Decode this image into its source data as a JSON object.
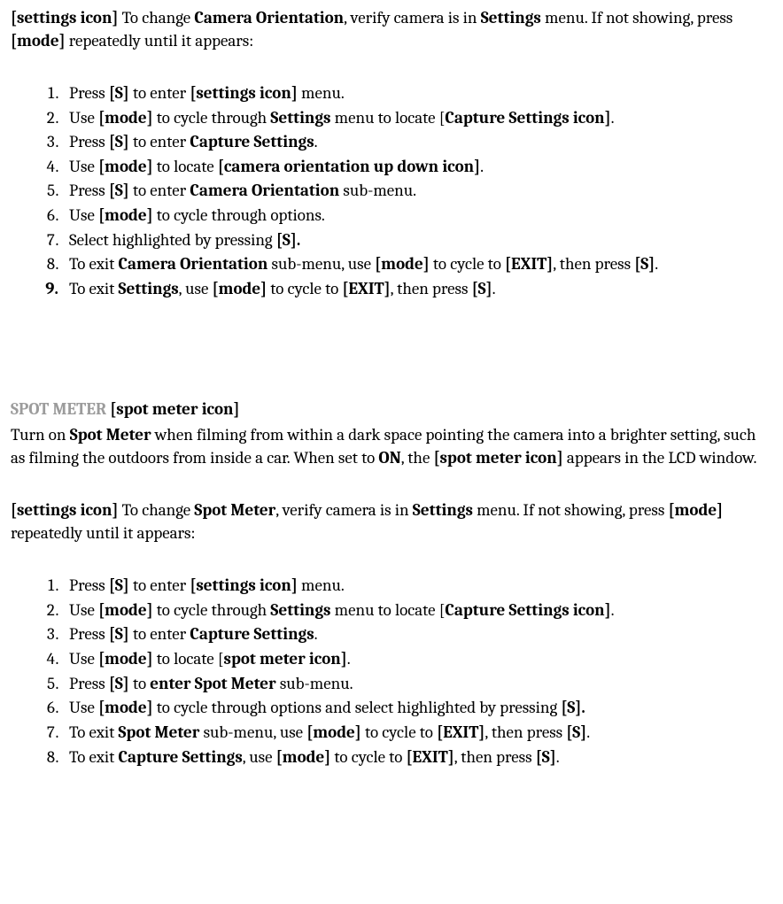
{
  "section1": {
    "intro_runs": [
      {
        "t": "[settings icon] ",
        "b": true
      },
      {
        "t": "To change ",
        "b": false
      },
      {
        "t": "Camera Orientation",
        "b": true
      },
      {
        "t": ", verify camera is in ",
        "b": false
      },
      {
        "t": "Settings",
        "b": true
      },
      {
        "t": " menu. If not showing, press ",
        "b": false
      },
      {
        "t": "[mode]",
        "b": true
      },
      {
        "t": " repeatedly until it appears:",
        "b": false
      }
    ],
    "steps": [
      [
        {
          "t": "Press ",
          "b": false
        },
        {
          "t": "[S]",
          "b": true
        },
        {
          "t": " to enter ",
          "b": false
        },
        {
          "t": "[settings icon]",
          "b": true
        },
        {
          "t": " menu.",
          "b": false
        }
      ],
      [
        {
          "t": "Use ",
          "b": false
        },
        {
          "t": "[mode]",
          "b": true
        },
        {
          "t": " to cycle through ",
          "b": false
        },
        {
          "t": "Settings",
          "b": true
        },
        {
          "t": " menu to locate [",
          "b": false
        },
        {
          "t": "Capture Settings icon]",
          "b": true
        },
        {
          "t": ".",
          "b": false
        }
      ],
      [
        {
          "t": "Press ",
          "b": false
        },
        {
          "t": "[S]",
          "b": true
        },
        {
          "t": " to enter ",
          "b": false
        },
        {
          "t": "Capture Settings",
          "b": true
        },
        {
          "t": ".",
          "b": false
        }
      ],
      [
        {
          "t": "Use ",
          "b": false
        },
        {
          "t": "[mode]",
          "b": true
        },
        {
          "t": " to locate ",
          "b": false
        },
        {
          "t": "[camera orientation up down icon]",
          "b": true
        },
        {
          "t": ".",
          "b": false
        }
      ],
      [
        {
          "t": "Press ",
          "b": false
        },
        {
          "t": "[S]",
          "b": true
        },
        {
          "t": " to enter ",
          "b": false
        },
        {
          "t": "Camera Orientation",
          "b": true
        },
        {
          "t": " sub-menu.",
          "b": false
        }
      ],
      [
        {
          "t": "Use ",
          "b": false
        },
        {
          "t": "[mode]",
          "b": true
        },
        {
          "t": " to cycle through options.",
          "b": false
        }
      ],
      [
        {
          "t": "Select highlighted by pressing ",
          "b": false
        },
        {
          "t": "[S].",
          "b": true
        }
      ],
      [
        {
          "t": "To exit ",
          "b": false
        },
        {
          "t": "Camera Orientation",
          "b": true
        },
        {
          "t": " sub-menu, use ",
          "b": false
        },
        {
          "t": "[mode]",
          "b": true
        },
        {
          "t": " to cycle to ",
          "b": false
        },
        {
          "t": "[EXIT]",
          "b": true
        },
        {
          "t": ", then press ",
          "b": false
        },
        {
          "t": "[S]",
          "b": true
        },
        {
          "t": ".",
          "b": false
        }
      ],
      [
        {
          "t": "To exit ",
          "b": false
        },
        {
          "t": "Settings",
          "b": true
        },
        {
          "t": ", use ",
          "b": false
        },
        {
          "t": "[mode]",
          "b": true
        },
        {
          "t": " to cycle to ",
          "b": false
        },
        {
          "t": "[EXIT]",
          "b": true
        },
        {
          "t": ", then press ",
          "b": false
        },
        {
          "t": "[S]",
          "b": true
        },
        {
          "t": ".",
          "b": false
        }
      ]
    ],
    "step9_numbold": true
  },
  "section2": {
    "heading_gray": "SPOT METER ",
    "heading_black": "[spot meter icon]",
    "desc_runs": [
      {
        "t": "Turn on ",
        "b": false
      },
      {
        "t": "Spot Meter",
        "b": true
      },
      {
        "t": " when filming from within a dark space pointing the camera into a brighter setting, such as filming the outdoors from inside a car. When set to ",
        "b": false
      },
      {
        "t": "ON",
        "b": true
      },
      {
        "t": ", the ",
        "b": false
      },
      {
        "t": "[spot meter icon]",
        "b": true
      },
      {
        "t": " appears in the LCD window.",
        "b": false
      }
    ],
    "intro_runs": [
      {
        "t": " [settings icon] ",
        "b": true
      },
      {
        "t": "To change ",
        "b": false
      },
      {
        "t": "Spot Meter",
        "b": true
      },
      {
        "t": ", verify camera is in ",
        "b": false
      },
      {
        "t": "Settings",
        "b": true
      },
      {
        "t": " menu. If not showing, press ",
        "b": false
      },
      {
        "t": "[mode]",
        "b": true
      },
      {
        "t": " repeatedly until it appears:",
        "b": false
      }
    ],
    "steps": [
      [
        {
          "t": "Press ",
          "b": false
        },
        {
          "t": "[S]",
          "b": true
        },
        {
          "t": " to enter ",
          "b": false
        },
        {
          "t": "[settings icon]",
          "b": true
        },
        {
          "t": " menu.",
          "b": false
        }
      ],
      [
        {
          "t": "Use ",
          "b": false
        },
        {
          "t": "[mode]",
          "b": true
        },
        {
          "t": " to cycle through ",
          "b": false
        },
        {
          "t": "Settings",
          "b": true
        },
        {
          "t": " menu to locate [",
          "b": false
        },
        {
          "t": "Capture Settings icon]",
          "b": true
        },
        {
          "t": ".",
          "b": false
        }
      ],
      [
        {
          "t": "Press ",
          "b": false
        },
        {
          "t": "[S]",
          "b": true
        },
        {
          "t": " to enter ",
          "b": false
        },
        {
          "t": "Capture Settings",
          "b": true
        },
        {
          "t": ".",
          "b": false
        }
      ],
      [
        {
          "t": "Use ",
          "b": false
        },
        {
          "t": "[mode]",
          "b": true
        },
        {
          "t": " to locate [",
          "b": false
        },
        {
          "t": "spot meter icon]",
          "b": true
        },
        {
          "t": ".",
          "b": false
        }
      ],
      [
        {
          "t": "Press ",
          "b": false
        },
        {
          "t": "[S]",
          "b": true
        },
        {
          "t": " to ",
          "b": false
        },
        {
          "t": "enter Spot Meter",
          "b": true
        },
        {
          "t": " sub-menu.",
          "b": false
        }
      ],
      [
        {
          "t": "Use ",
          "b": false
        },
        {
          "t": "[mode]",
          "b": true
        },
        {
          "t": " to cycle through options and select highlighted by pressing ",
          "b": false
        },
        {
          "t": "[S].",
          "b": true
        }
      ],
      [
        {
          "t": "To exit ",
          "b": false
        },
        {
          "t": "Spot Meter",
          "b": true
        },
        {
          "t": " sub-menu, use ",
          "b": false
        },
        {
          "t": "[mode]",
          "b": true
        },
        {
          "t": " to cycle to ",
          "b": false
        },
        {
          "t": "[EXIT]",
          "b": true
        },
        {
          "t": ", then press ",
          "b": false
        },
        {
          "t": "[S]",
          "b": true
        },
        {
          "t": ".",
          "b": false
        }
      ],
      [
        {
          "t": "To exit ",
          "b": false
        },
        {
          "t": "Capture Settings",
          "b": true
        },
        {
          "t": ", use ",
          "b": false
        },
        {
          "t": "[mode]",
          "b": true
        },
        {
          "t": " to cycle to ",
          "b": false
        },
        {
          "t": "[EXIT]",
          "b": true
        },
        {
          "t": ", then press ",
          "b": false
        },
        {
          "t": "[S]",
          "b": true
        },
        {
          "t": ".",
          "b": false
        }
      ]
    ]
  }
}
